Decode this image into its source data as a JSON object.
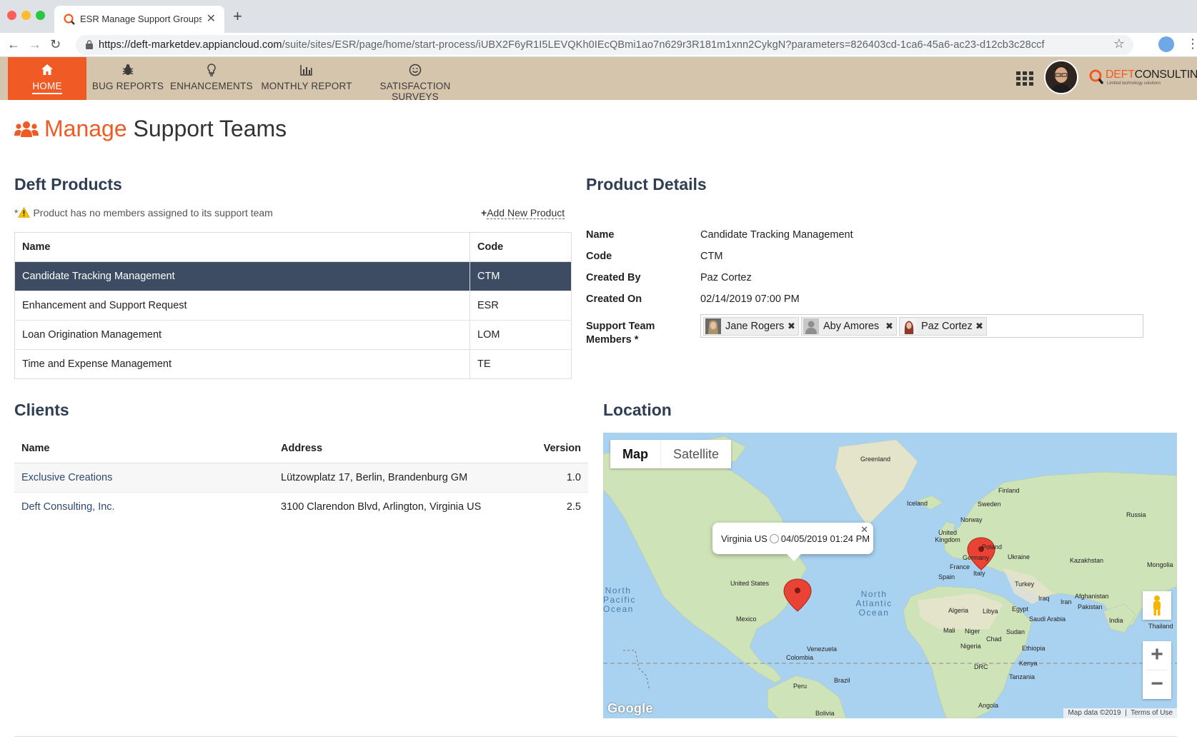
{
  "browser": {
    "tab_title": "ESR Manage Support Groups - ",
    "url_host": "https://deft-marketdev.appiancloud.com",
    "url_path": "/suite/sites/ESR/page/home/start-process/iUBX2F6yR1I5LEVQKh0IEcQBmi1ao7n629r3R181m1xnn2CykgN?parameters=826403cd-1ca6-45a6-ac23-d12cb3c28ccf"
  },
  "nav": {
    "items": [
      {
        "label": "HOME",
        "icon": "home-icon"
      },
      {
        "label": "BUG REPORTS",
        "icon": "bug-icon"
      },
      {
        "label": "ENHANCEMENTS",
        "icon": "lightbulb-icon"
      },
      {
        "label": "MONTHLY REPORT",
        "icon": "bar-chart-icon"
      },
      {
        "label": "SATISFACTION SURVEYS",
        "icon": "smiley-icon"
      }
    ],
    "active": "HOME",
    "logo_main": "DEFT",
    "logo_second": "CONSULTING",
    "logo_tagline": "Limited technology solutions",
    "accent_color": "#f05a24",
    "header_color": "#d6c5ad"
  },
  "page": {
    "title_accent": "Manage",
    "title_rest": " Support Teams"
  },
  "products": {
    "heading": "Deft Products",
    "note": "Product has no members assigned to its support team",
    "note_prefix": "*",
    "add_link": "Add New Product",
    "columns": [
      "Name",
      "Code"
    ],
    "rows": [
      {
        "name": "Candidate Tracking Management",
        "code": "CTM",
        "selected": true
      },
      {
        "name": "Enhancement and Support Request",
        "code": "ESR"
      },
      {
        "name": "Loan Origination Management",
        "code": "LOM"
      },
      {
        "name": "Time and Expense Management",
        "code": "TE"
      }
    ]
  },
  "details": {
    "heading": "Product Details",
    "fields": [
      {
        "label": "Name",
        "value": "Candidate Tracking Management"
      },
      {
        "label": "Code",
        "value": "CTM"
      },
      {
        "label": "Created By",
        "value": "Paz Cortez"
      },
      {
        "label": "Created On",
        "value": "02/14/2019 07:00 PM"
      }
    ],
    "members_label_1": "Support Team",
    "members_label_2": "Members *",
    "members": [
      "Jane Rogers",
      "Aby Amores",
      "Paz Cortez"
    ]
  },
  "clients": {
    "heading": "Clients",
    "columns": [
      "Name",
      "Address",
      "Version"
    ],
    "rows": [
      {
        "name": "Exclusive Creations",
        "address": "Lützowplatz 17, Berlin, Brandenburg GM",
        "version": "1.0"
      },
      {
        "name": "Deft Consulting, Inc.",
        "address": "3100 Clarendon Blvd, Arlington, Virginia US",
        "version": "2.5"
      }
    ]
  },
  "location": {
    "heading": "Location",
    "map_type_on": "Map",
    "map_type_off": "Satellite",
    "info_place": "Virginia US",
    "info_time": "04/05/2019 01:24 PM",
    "attribution": "Map data ©2019",
    "terms": "Terms of Use",
    "google": "Google",
    "labels": {
      "greenland": "Greenland",
      "iceland": "Iceland",
      "finland": "Finland",
      "sweden": "Sweden",
      "norway": "Norway",
      "russia": "Russia",
      "uk": "United Kingdom",
      "poland": "Poland",
      "germany": "Germany",
      "ukraine": "Ukraine",
      "france": "France",
      "kazakhstan": "Kazakhstan",
      "mongolia": "Mongolia",
      "spain": "Spain",
      "italy": "Italy",
      "turkey": "Turkey",
      "us": "United States",
      "mexico": "Mexico",
      "iraq": "Iraq",
      "iran": "Iran",
      "afghanistan": "Afghanistan",
      "pakistan": "Pakistan",
      "algeria": "Algeria",
      "libya": "Libya",
      "egypt": "Egypt",
      "saudi": "Saudi Arabia",
      "india": "India",
      "thailand": "Thailand",
      "mali": "Mali",
      "niger": "Niger",
      "chad": "Chad",
      "sudan": "Sudan",
      "nigeria": "Nigeria",
      "ethiopia": "Ethiopia",
      "venezuela": "Venezuela",
      "colombia": "Colombia",
      "kenya": "Kenya",
      "drc": "DRC",
      "tanzania": "Tanzania",
      "peru": "Peru",
      "brazil": "Brazil",
      "angola": "Angola",
      "bolivia": "Bolivia",
      "pacific": "North Pacific Ocean",
      "atlantic": "North Atlantic Ocean"
    }
  }
}
